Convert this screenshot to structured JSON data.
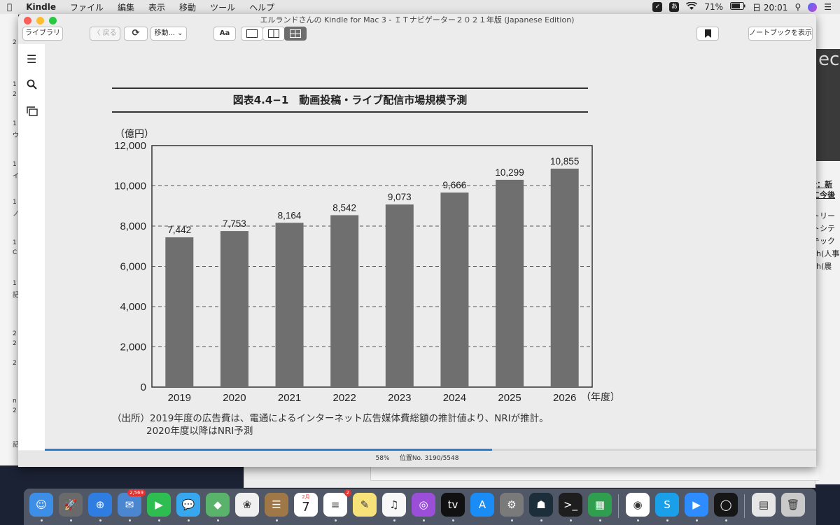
{
  "menubar": {
    "apple": "",
    "app": "Kindle",
    "items": [
      "ファイル",
      "編集",
      "表示",
      "移動",
      "ツール",
      "ヘルプ"
    ],
    "ime": "あ",
    "battery": "71%",
    "clock": "日 20:01"
  },
  "window": {
    "title": "エルランドさんの Kindle for Mac 3 - ＩＴナビゲーター２０２１年版 (Japanese Edition)"
  },
  "toolbar": {
    "library": "ライブラリ",
    "back": "〈 戻る",
    "goto": "移動... ⌄",
    "font": "Aa",
    "notebook": "ノートブックを表示"
  },
  "figure": {
    "title": "図表4.4−1　動画投稿・ライブ配信市場規模予測",
    "note_line1": "（出所）2019年度の広告費は、電通によるインターネット広告媒体費総額の推計値より、NRIが推計。",
    "note_line2": "2020年度以降はNRI予測"
  },
  "chart_data": {
    "type": "bar",
    "title": "図表4.4−1　動画投稿・ライブ配信市場規模予測",
    "ylabel": "（億円）",
    "xlabel": "（年度）",
    "categories": [
      "2019",
      "2020",
      "2021",
      "2022",
      "2023",
      "2024",
      "2025",
      "2026"
    ],
    "values": [
      7442,
      7753,
      8164,
      8542,
      9073,
      9666,
      10299,
      10855
    ],
    "value_labels": [
      "7,442",
      "7,753",
      "8,164",
      "8,542",
      "9,073",
      "9,666",
      "10,299",
      "10,855"
    ],
    "ylim": [
      0,
      12000
    ],
    "yticks": [
      "0",
      "2,000",
      "4,000",
      "6,000",
      "8,000",
      "10,000",
      "12,000"
    ],
    "grid": "dashed-horizontal",
    "bar_color": "#6f6f6f"
  },
  "status": {
    "percent": "58%",
    "location": "位置No. 3190/5548",
    "progress": 0.58
  },
  "dock": {
    "mail_badge": "2,569",
    "reminders_badge": "2",
    "calendar_month": "2月",
    "calendar_day": "7",
    "apps": [
      "finder-icon",
      "launchpad-icon",
      "safari-icon",
      "mail-icon",
      "facetime-icon",
      "messages-icon",
      "maps-icon",
      "photos-icon",
      "contacts-icon",
      "calendar-icon",
      "reminders-icon",
      "notes-icon",
      "music-icon",
      "podcasts-icon",
      "tv-icon",
      "app-store-icon",
      "system-preferences-icon",
      "kindle-icon",
      "terminal-icon",
      "keynote-icon",
      "chrome-icon",
      "skype-icon",
      "zoom-icon",
      "activity-icon",
      "downloads-icon",
      "trash-icon"
    ]
  },
  "bg_right": {
    "book_text": "ec",
    "lines": [
      "y：新",
      "に今後",
      "トリー",
      "トシテ",
      "テック",
      "ch(人事",
      "ch(農"
    ]
  },
  "bg_left": {
    "lines": [
      "2",
      "1",
      "2",
      "1",
      "ウ",
      "1",
      "イ",
      "1",
      "ノ",
      "1",
      "C",
      "1",
      "記",
      "2",
      "2",
      "2",
      "n",
      "2",
      "記"
    ]
  }
}
